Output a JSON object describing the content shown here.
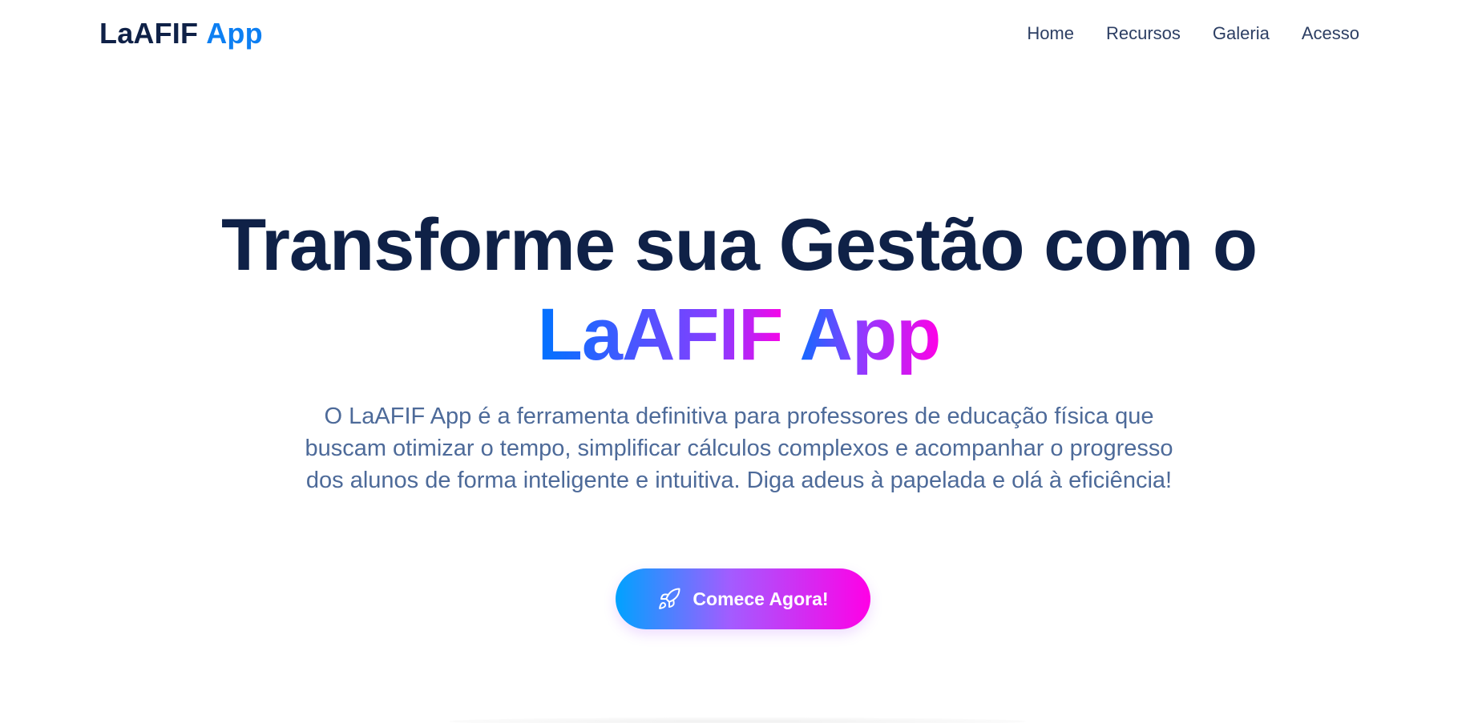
{
  "header": {
    "logo_main": "LaAFIF",
    "logo_accent": "App",
    "nav": [
      {
        "label": "Home"
      },
      {
        "label": "Recursos"
      },
      {
        "label": "Galeria"
      },
      {
        "label": "Acesso"
      }
    ]
  },
  "hero": {
    "title_line1": "Transforme sua Gestão com o",
    "title_brand": "LaAFIF App",
    "description": "O LaAFIF App é a ferramenta definitiva para professores de educação física que buscam otimizar o tempo, simplificar cálculos complexos e acompanhar o progresso dos alunos de forma inteligente e intuitiva. Diga adeus à papelada e olá à eficiência!",
    "cta_label": "Comece Agora!",
    "cta_icon": "rocket-icon"
  },
  "colors": {
    "title": "#0f2147",
    "logo_accent": "#0d7ff2",
    "gradient_start": "#00a2ff",
    "gradient_end": "#ff00e6",
    "description": "#4d6a99"
  }
}
